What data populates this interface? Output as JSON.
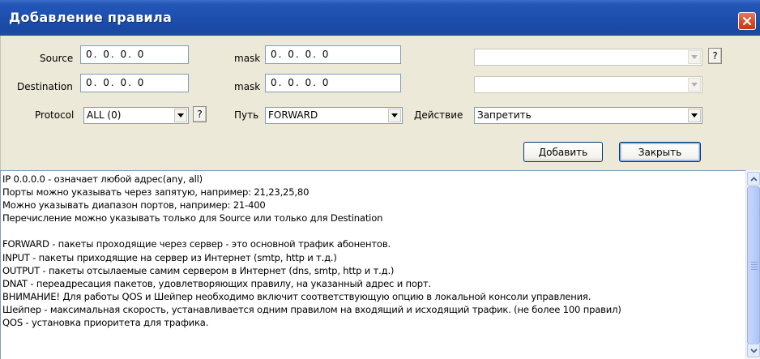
{
  "window": {
    "title": "Добавление правила"
  },
  "form": {
    "source_label": "Source",
    "source_value": "0. 0. 0. 0",
    "source_mask_label": "mask",
    "source_mask_value": "0. 0. 0. 0",
    "destination_label": "Destination",
    "destination_value": "0. 0. 0. 0",
    "destination_mask_label": "mask",
    "destination_mask_value": "0. 0. 0. 0",
    "protocol_label": "Protocol",
    "protocol_value": "ALL (0)",
    "path_label": "Путь",
    "path_value": "FORWARD",
    "action_label": "Действие",
    "action_value": "Запретить",
    "right_combo_1_value": "",
    "right_combo_2_value": "",
    "help_label": "?"
  },
  "buttons": {
    "add": "Добавить",
    "close": "Закрыть"
  },
  "info_lines": [
    "IP 0.0.0.0 - означает любой адрес(any, all)",
    "Порты можно указывать через запятую, например: 21,23,25,80",
    "Можно указывать диапазон портов, например: 21-400",
    "Перечисление можно указывать только для Source или только для Destination",
    "",
    "FORWARD - пакеты проходящие через сервер - это основной трафик абонентов.",
    "INPUT - пакеты приходящие на сервер из Интернет (smtp, http и т.д.)",
    "OUTPUT - пакеты отсылаемые самим сервером в Интернет (dns, smtp, http и т.д.)",
    "DNAT - переадресация пакетов, удовлетворяющих правилу, на указанный адрес и порт.",
    "ВНИМАНИЕ! Для работы QOS и Шейпер необходимо включит соответствующую опцию в локальной консоли управления.",
    "Шейпер - максимальная скорость, устанавливается одним правилом на входящий и исходящий трафик. (не более 100 правил)",
    "QOS - установка приоритета для трафика."
  ],
  "colors": {
    "titlebar": "#1d4fae",
    "close": "#d24a22",
    "dialog_bg": "#ece9d8",
    "field_border": "#7f9db9"
  }
}
